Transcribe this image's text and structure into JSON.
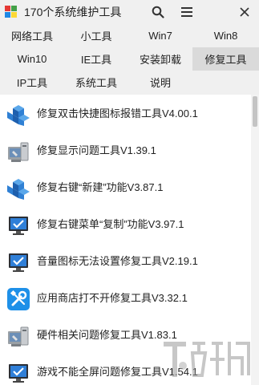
{
  "app": {
    "title": "170个系统维护工具"
  },
  "icons": {
    "search": "search-icon",
    "menu": "hamburger-menu-icon",
    "close": "close-icon"
  },
  "tabs": [
    {
      "label": "网络工具",
      "active": false
    },
    {
      "label": "小工具",
      "active": false
    },
    {
      "label": "Win7",
      "active": false
    },
    {
      "label": "Win8",
      "active": false
    },
    {
      "label": "Win10",
      "active": false
    },
    {
      "label": "IE工具",
      "active": false
    },
    {
      "label": "安装卸载",
      "active": false
    },
    {
      "label": "修复工具",
      "active": true
    },
    {
      "label": "IP工具",
      "active": false
    },
    {
      "label": "系统工具",
      "active": false
    },
    {
      "label": "说明",
      "active": false
    }
  ],
  "items": [
    {
      "label": "修复双击快捷图标报错工具V4.00.1",
      "icon": "blue-cubes-icon"
    },
    {
      "label": "修复显示问题工具V1.39.1",
      "icon": "computer-tool-icon"
    },
    {
      "label": "修复右键“新建”功能V3.87.1",
      "icon": "blue-cubes-icon"
    },
    {
      "label": "修复右键菜单“复制”功能V3.97.1",
      "icon": "monitor-check-icon"
    },
    {
      "label": "音量图标无法设置修复工具V2.19.1",
      "icon": "monitor-check-icon"
    },
    {
      "label": "应用商店打不开修复工具V3.32.1",
      "icon": "wrench-screwdriver-icon"
    },
    {
      "label": "硬件相关问题修复工具V1.83.1",
      "icon": "computer-tool-icon"
    },
    {
      "label": "游戏不能全屏问题修复工具V1.54.1",
      "icon": "monitor-check-icon"
    }
  ],
  "colors": {
    "tab_bar": "#f0f0f0",
    "active_tab": "#dadada",
    "accent_blue": "#1e6fd9",
    "text": "#222222"
  }
}
